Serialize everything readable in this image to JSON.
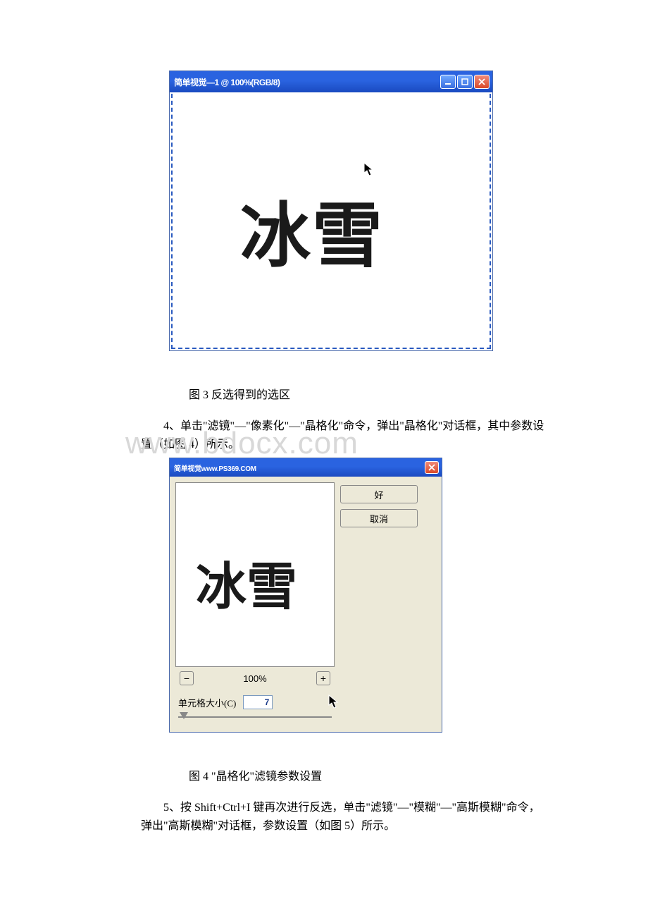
{
  "embed1": {
    "window_title": "简单视觉—1 @ 100%(RGB/8)",
    "canvas_text": "冰雪"
  },
  "caption1": "图 3 反选得到的选区",
  "para1": "4、单击\"滤镜\"—\"像素化\"—\"晶格化\"命令，弹出\"晶格化\"对话框，其中参数设置（如图 4）所示。",
  "watermark": "www.bdocx.com",
  "embed2": {
    "titlebar_watermark": "简单视觉www.PS369.COM",
    "ok_label": "好",
    "cancel_label": "取消",
    "preview_text": "冰雪",
    "zoom_percent": "100%",
    "param_label": "单元格大小(C)",
    "param_value": "7"
  },
  "caption2": "图 4 \"晶格化\"滤镜参数设置",
  "para2": "5、按 Shift+Ctrl+I 键再次进行反选，单击\"滤镜\"—\"模糊\"—\"高斯模糊\"命令，弹出\"高斯模糊\"对话框，参数设置（如图 5）所示。"
}
